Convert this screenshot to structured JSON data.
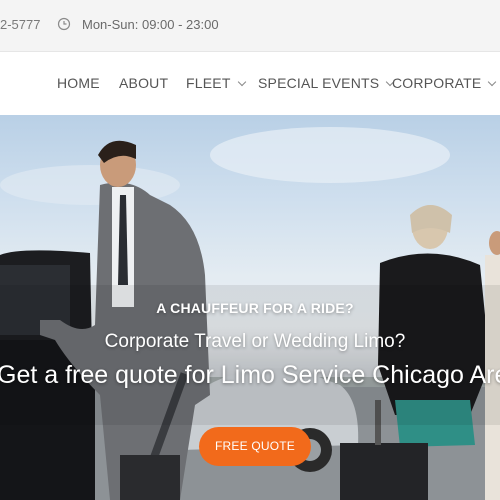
{
  "topbar": {
    "phone_text": "2-5777",
    "clock_icon": "clock-icon",
    "hours_text": "Mon-Sun: 09:00 - 23:00"
  },
  "nav": {
    "items": [
      {
        "label": "HOME",
        "has_dropdown": false
      },
      {
        "label": "ABOUT",
        "has_dropdown": false
      },
      {
        "label": "FLEET",
        "has_dropdown": true
      },
      {
        "label": "SPECIAL EVENTS",
        "has_dropdown": true
      },
      {
        "label": "CORPORATE",
        "has_dropdown": true
      }
    ]
  },
  "hero": {
    "eyebrow": "A CHAUFFEUR FOR A RIDE?",
    "subtitle": "Corporate Travel or Wedding Limo?",
    "headline": "Get a free quote for Limo Service Chicago Are",
    "cta_label": "FREE QUOTE"
  },
  "colors": {
    "accent": "#f26a1b",
    "nav_text": "#555555",
    "topbar_bg": "#f4f4f4"
  }
}
